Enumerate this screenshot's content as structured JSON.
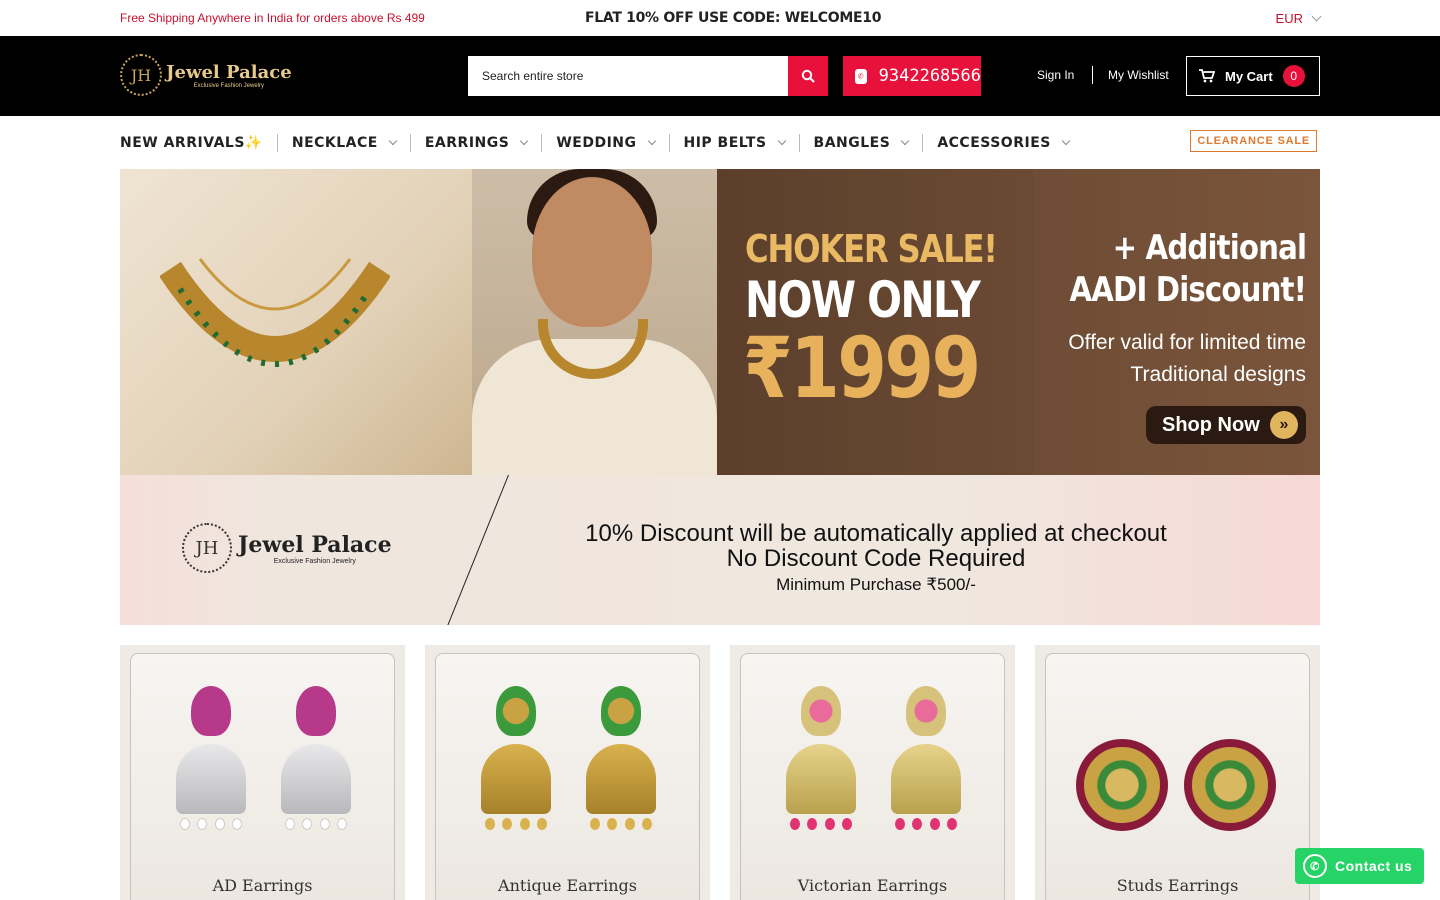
{
  "topbar": {
    "shipping_text": "Free Shipping Anywhere in India for orders above Rs 499",
    "coupon_text": "FLAT 10% OFF USE CODE: WELCOME10",
    "currency": "EUR"
  },
  "header": {
    "logo_name": "Jewel Palace",
    "logo_tagline": "Exclusive Fashion Jewelry",
    "search_placeholder": "Search entire store",
    "phone": "9342268566",
    "signin_label": "Sign In",
    "wishlist_label": "My Wishlist",
    "cart_label": "My Cart",
    "cart_count": "0"
  },
  "nav": {
    "items": [
      {
        "label": "NEW ARRIVALS✨"
      },
      {
        "label": "NECKLACE"
      },
      {
        "label": "EARRINGS"
      },
      {
        "label": "WEDDING"
      },
      {
        "label": "HIP BELTS"
      },
      {
        "label": "BANGLES"
      },
      {
        "label": "ACCESSORIES"
      }
    ],
    "clearance_label": "CLEARANCE SALE"
  },
  "hero": {
    "headline": "CHOKER SALE!",
    "subline": "NOW ONLY",
    "price": "₹1999",
    "additional_line1": "+ Additional",
    "additional_line2": "AADI Discount!",
    "offer_line1": "Offer valid for limited time",
    "offer_line2": "Traditional designs",
    "cta_label": "Shop Now"
  },
  "discount_banner": {
    "logo_name": "Jewel Palace",
    "logo_tagline": "Exclusive Fashion Jewelry",
    "line1": "10% Discount will be automatically applied at checkout",
    "line2": "No Discount Code Required",
    "line3": "Minimum Purchase ₹500/-"
  },
  "categories": [
    {
      "label": "AD Earrings"
    },
    {
      "label": "Antique Earrings"
    },
    {
      "label": "Victorian Earrings"
    },
    {
      "label": "Studs Earrings"
    }
  ],
  "whatsapp": {
    "label": "Contact us"
  },
  "colors": {
    "accent": "#e7113c",
    "clearance": "#e07a2e",
    "whatsapp": "#25d366"
  }
}
